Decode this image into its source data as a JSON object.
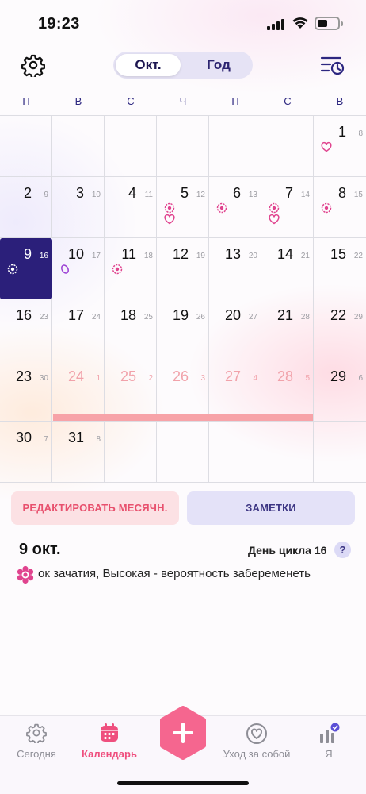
{
  "status": {
    "time": "19:23"
  },
  "header": {
    "seg_month": "Окт.",
    "seg_year": "Год"
  },
  "weekdays": [
    "П",
    "В",
    "С",
    "Ч",
    "П",
    "С",
    "В"
  ],
  "calendar": {
    "days": [
      {
        "n": "1",
        "c": "8",
        "icons": [
          "heart"
        ]
      },
      {
        "n": "2",
        "c": "9"
      },
      {
        "n": "3",
        "c": "10"
      },
      {
        "n": "4",
        "c": "11"
      },
      {
        "n": "5",
        "c": "12",
        "icons": [
          "flower",
          "heart"
        ]
      },
      {
        "n": "6",
        "c": "13",
        "icons": [
          "flower"
        ]
      },
      {
        "n": "7",
        "c": "14",
        "icons": [
          "flower",
          "heart"
        ]
      },
      {
        "n": "8",
        "c": "15",
        "icons": [
          "flower"
        ]
      },
      {
        "n": "9",
        "c": "16",
        "icons": [
          "flower"
        ],
        "selected": true
      },
      {
        "n": "10",
        "c": "17",
        "icons": [
          "oval"
        ]
      },
      {
        "n": "11",
        "c": "18",
        "icons": [
          "flower"
        ]
      },
      {
        "n": "12",
        "c": "19"
      },
      {
        "n": "13",
        "c": "20"
      },
      {
        "n": "14",
        "c": "21"
      },
      {
        "n": "15",
        "c": "22"
      },
      {
        "n": "16",
        "c": "23"
      },
      {
        "n": "17",
        "c": "24"
      },
      {
        "n": "18",
        "c": "25"
      },
      {
        "n": "19",
        "c": "26"
      },
      {
        "n": "20",
        "c": "27"
      },
      {
        "n": "21",
        "c": "28"
      },
      {
        "n": "22",
        "c": "29"
      },
      {
        "n": "23",
        "c": "30"
      },
      {
        "n": "24",
        "c": "1",
        "period": true
      },
      {
        "n": "25",
        "c": "2",
        "period": true
      },
      {
        "n": "26",
        "c": "3",
        "period": true
      },
      {
        "n": "27",
        "c": "4",
        "period": true
      },
      {
        "n": "28",
        "c": "5",
        "period": true
      },
      {
        "n": "29",
        "c": "6"
      },
      {
        "n": "30",
        "c": "7"
      },
      {
        "n": "31",
        "c": "8"
      }
    ],
    "first_weekday_index": 6
  },
  "actions": {
    "edit_label": "РЕДАКТИРОВАТЬ МЕСЯЧН.",
    "notes_label": "ЗАМЕТКИ"
  },
  "day_info": {
    "title": "9 окт.",
    "cycle_day": "День цикла 16",
    "help": "?",
    "text": "ок зачатия, Высокая - вероятность забеременеть"
  },
  "nav": {
    "today": "Сегодня",
    "calendar": "Календарь",
    "selfcare": "Уход за собой",
    "me": "Я"
  },
  "colors": {
    "accent": "#ef4f7e",
    "selected": "#2b1f7a",
    "period": "#f7a3a8",
    "fertile_icon": "#e0438e"
  }
}
